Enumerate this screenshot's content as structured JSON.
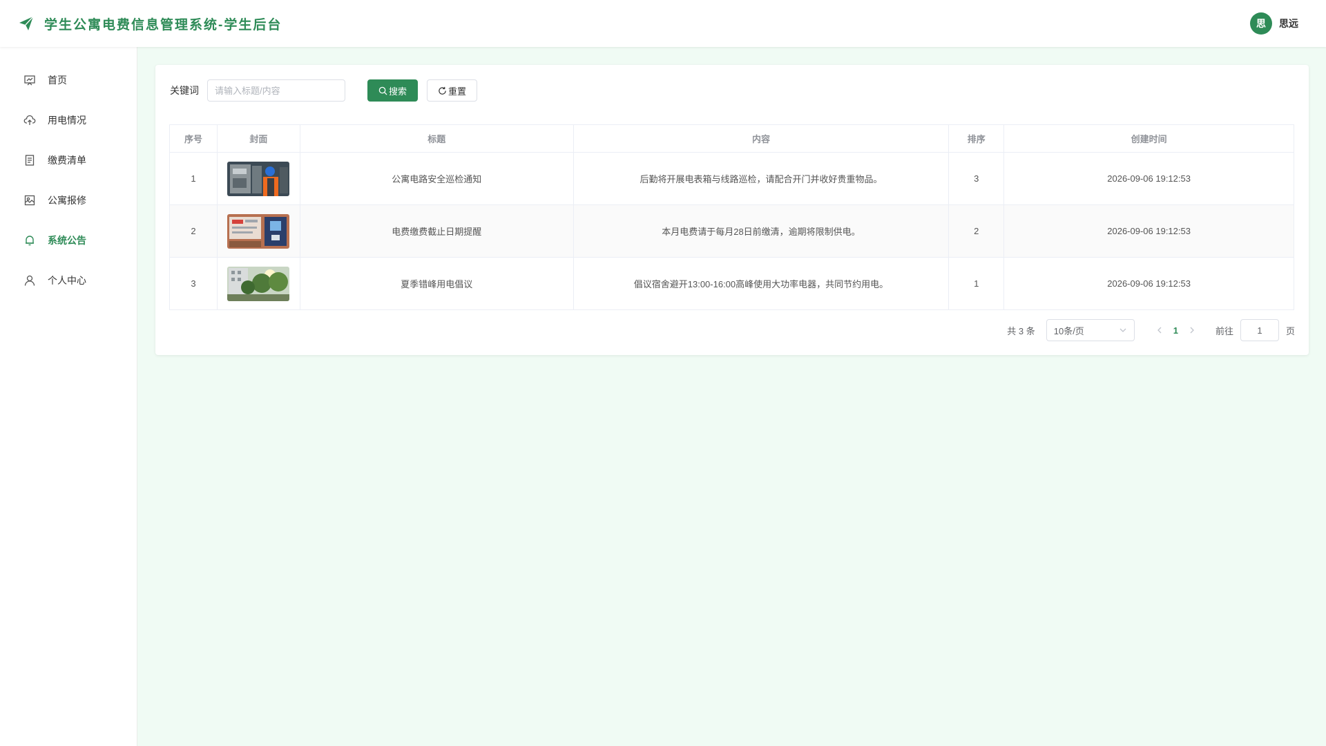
{
  "header": {
    "title": "学生公寓电费信息管理系统-学生后台",
    "user": {
      "avatar_char": "思",
      "name": "思远"
    },
    "brand_color": "#2e8b57"
  },
  "sidebar": {
    "items": [
      {
        "label": "首页",
        "icon": "home-chart-icon"
      },
      {
        "label": "用电情况",
        "icon": "cloud-upload-icon"
      },
      {
        "label": "缴费清单",
        "icon": "document-icon"
      },
      {
        "label": "公寓报修",
        "icon": "repair-icon"
      },
      {
        "label": "系统公告",
        "icon": "bell-icon",
        "active": true
      },
      {
        "label": "个人中心",
        "icon": "user-icon"
      }
    ]
  },
  "search": {
    "label": "关键词",
    "placeholder": "请输入标题/内容",
    "value": "",
    "search_button": "搜索",
    "reset_button": "重置"
  },
  "table": {
    "columns": [
      "序号",
      "封面",
      "标题",
      "内容",
      "排序",
      "创建时间"
    ],
    "rows": [
      {
        "index": "1",
        "cover": "electrician-inspection-photo",
        "title": "公寓电路安全巡检通知",
        "content": "后勤将开展电表箱与线路巡检，请配合开门并收好贵重物品。",
        "order": "3",
        "created": "2026-09-06 19:12:53"
      },
      {
        "index": "2",
        "cover": "meter-panel-photo",
        "title": "电费缴费截止日期提醒",
        "content": "本月电费请于每月28日前缴清，逾期将限制供电。",
        "order": "2",
        "created": "2026-09-06 19:12:53"
      },
      {
        "index": "3",
        "cover": "dorm-trees-photo",
        "title": "夏季错峰用电倡议",
        "content": "倡议宿舍避开13:00-16:00高峰使用大功率电器，共同节约用电。",
        "order": "1",
        "created": "2026-09-06 19:12:53"
      }
    ]
  },
  "pagination": {
    "total_text": "共 3 条",
    "page_size": "10条/页",
    "current_page": "1",
    "goto_label": "前往",
    "goto_value": "1",
    "page_suffix": "页"
  }
}
